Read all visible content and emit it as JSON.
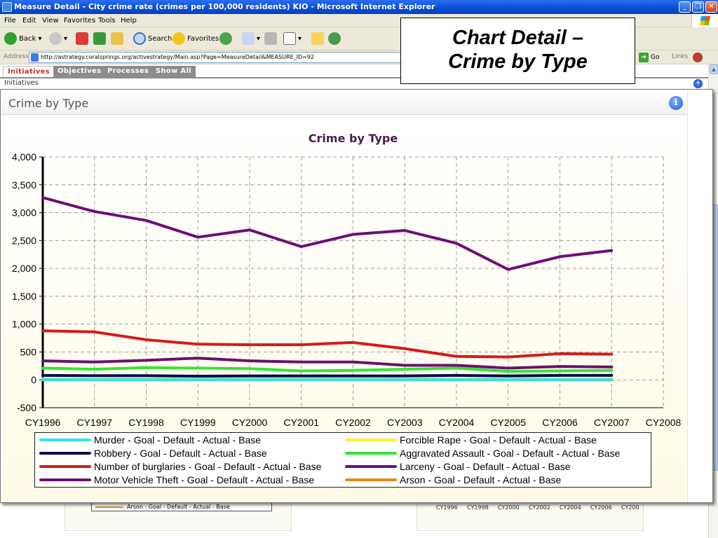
{
  "window": {
    "title": "Measure Detail - City crime rate (crimes per 100,000 residents) KIO - Microsoft Internet Explorer"
  },
  "menu": [
    "File",
    "Edit",
    "View",
    "Favorites",
    "Tools",
    "Help"
  ],
  "toolbar": {
    "back_label": "Back",
    "search_label": "Search",
    "favorites_label": "Favorites"
  },
  "address": {
    "label": "Address",
    "url": "http://astrategy.coralsprings.org/activestrategy/Main.asp?Page=MeasureDetail&MEASURE_ID=92",
    "go_label": "Go",
    "links_label": "Links"
  },
  "tabs": [
    "Initiatives",
    "Objectives",
    "Processes",
    "Show All"
  ],
  "subnav": {
    "label": "Initiatives"
  },
  "caption": {
    "line1": "Chart Detail –",
    "line2": "Crime by Type"
  },
  "popup": {
    "title": "Crime by Type"
  },
  "background": {
    "legend_item": "Arson - Goal - Default - Actual - Base",
    "x_ticks": [
      "CY1996",
      "CY1998",
      "CY2000",
      "CY2002",
      "CY2004",
      "CY2006",
      "CY200"
    ]
  },
  "colors": {
    "tab_active_text": "#c0392b",
    "chart_title": "#4b1a4e"
  },
  "chart_data": {
    "type": "line",
    "title": "Crime by Type",
    "xlabel": "",
    "ylabel": "",
    "categories": [
      "CY1996",
      "CY1997",
      "CY1998",
      "CY1999",
      "CY2000",
      "CY2001",
      "CY2002",
      "CY2003",
      "CY2004",
      "CY2005",
      "CY2006",
      "CY2007",
      "CY2008"
    ],
    "ylim": [
      -500,
      4000
    ],
    "yticks": [
      4000,
      3500,
      3000,
      2500,
      2000,
      1500,
      1000,
      500,
      0,
      -500
    ],
    "ytick_labels": [
      "4,000",
      "3,500",
      "3,000",
      "2,500",
      "2,000",
      "1,500",
      "1,000",
      "500",
      "0",
      "-500"
    ],
    "grid": true,
    "legend_position": "bottom",
    "series": [
      {
        "name": "Murder - Goal - Default - Actual - Base",
        "color": "#33e0f0",
        "values": [
          5,
          5,
          5,
          5,
          5,
          5,
          5,
          5,
          5,
          5,
          5,
          5
        ]
      },
      {
        "name": "Forcible Rape - Goal - Default - Actual - Base",
        "color": "#ffef33",
        "values": [
          20,
          20,
          20,
          20,
          20,
          20,
          20,
          20,
          20,
          20,
          20,
          20
        ]
      },
      {
        "name": "Robbery - Goal - Default - Actual - Base",
        "color": "#0c0c4a",
        "values": [
          80,
          75,
          75,
          65,
          70,
          70,
          70,
          70,
          80,
          70,
          80,
          80
        ]
      },
      {
        "name": "Aggravated Assault - Goal - Default - Actual - Base",
        "color": "#33e633",
        "values": [
          210,
          190,
          220,
          210,
          200,
          160,
          170,
          190,
          210,
          150,
          160,
          170
        ]
      },
      {
        "name": "Number of burglaries - Goal - Default - Actual - Base",
        "color": "#d41a1a",
        "values": [
          880,
          860,
          720,
          640,
          630,
          630,
          670,
          560,
          420,
          410,
          470,
          460
        ]
      },
      {
        "name": "Larceny - Goal - Default - Actual - Base",
        "color": "#6c0f75",
        "values": [
          3270,
          3020,
          2860,
          2560,
          2690,
          2390,
          2610,
          2680,
          2450,
          1980,
          2210,
          2320
        ]
      },
      {
        "name": "Motor Vehicle Theft - Goal - Default - Actual - Base",
        "color": "#6a1070",
        "values": [
          340,
          320,
          350,
          390,
          340,
          320,
          320,
          260,
          260,
          210,
          240,
          230
        ]
      },
      {
        "name": "Arson - Goal - Default - Actual - Base",
        "color": "#e08a1e",
        "values": [
          0,
          0,
          0,
          0,
          0,
          0,
          0,
          0,
          0,
          0,
          0,
          0
        ]
      }
    ]
  }
}
